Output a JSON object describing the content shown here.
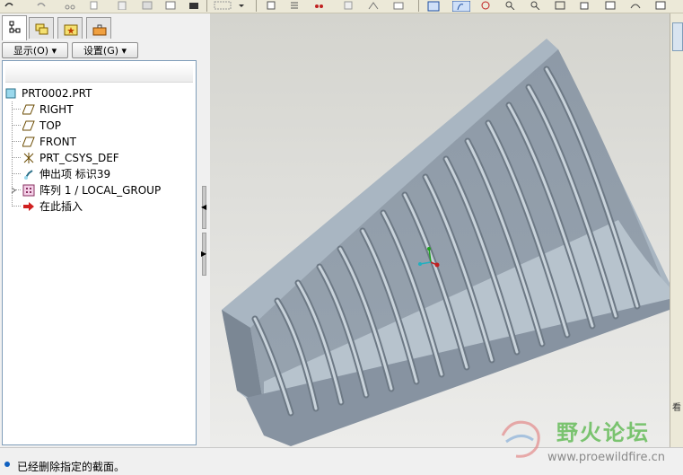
{
  "toolbar": {
    "icons": [
      "undo-icon",
      "redo-icon",
      "cut-icon",
      "copy-icon",
      "paste-icon",
      "paste-special-icon",
      "regenerate-icon",
      "feature-list-icon",
      "window-icon",
      "layer-icon",
      "sketch-icon",
      "datum-point-icon",
      "appearance-icon",
      "orient-icon",
      "spin-center-icon",
      "repaint-icon",
      "zoom-in-icon",
      "zoom-out-icon",
      "refit-icon",
      "saved-view-icon",
      "display-style-icon"
    ]
  },
  "left_panel": {
    "tabs": [
      "model-tree-tab",
      "layer-tree-tab",
      "favorites-tab",
      "tools-tab"
    ],
    "show_button": "显示(O) ▾",
    "settings_button": "设置(G) ▾",
    "tree": {
      "root": "PRT0002.PRT",
      "items": [
        {
          "label": "RIGHT",
          "icon": "datum-plane-icon"
        },
        {
          "label": "TOP",
          "icon": "datum-plane-icon"
        },
        {
          "label": "FRONT",
          "icon": "datum-plane-icon"
        },
        {
          "label": "PRT_CSYS_DEF",
          "icon": "csys-icon"
        },
        {
          "label": "伸出项 标识39",
          "icon": "extrude-icon"
        },
        {
          "label": "阵列 1 / LOCAL_GROUP",
          "icon": "pattern-icon"
        },
        {
          "label": "在此插入",
          "icon": "insert-here-arrow-icon"
        }
      ]
    }
  },
  "status_bar": {
    "message": "已经删除指定的截面。"
  },
  "right_strip": {
    "partial_text": "看"
  },
  "watermark": {
    "title": "野火论坛",
    "url": "www.proewildfire.cn"
  },
  "colors": {
    "model_top": "#a9b6c2",
    "model_front": "#8793a1",
    "model_dark": "#727e8b",
    "rib": "#b9c5d0",
    "viewport_bg": "#dededa",
    "watermark_green": "#7ac36f"
  }
}
